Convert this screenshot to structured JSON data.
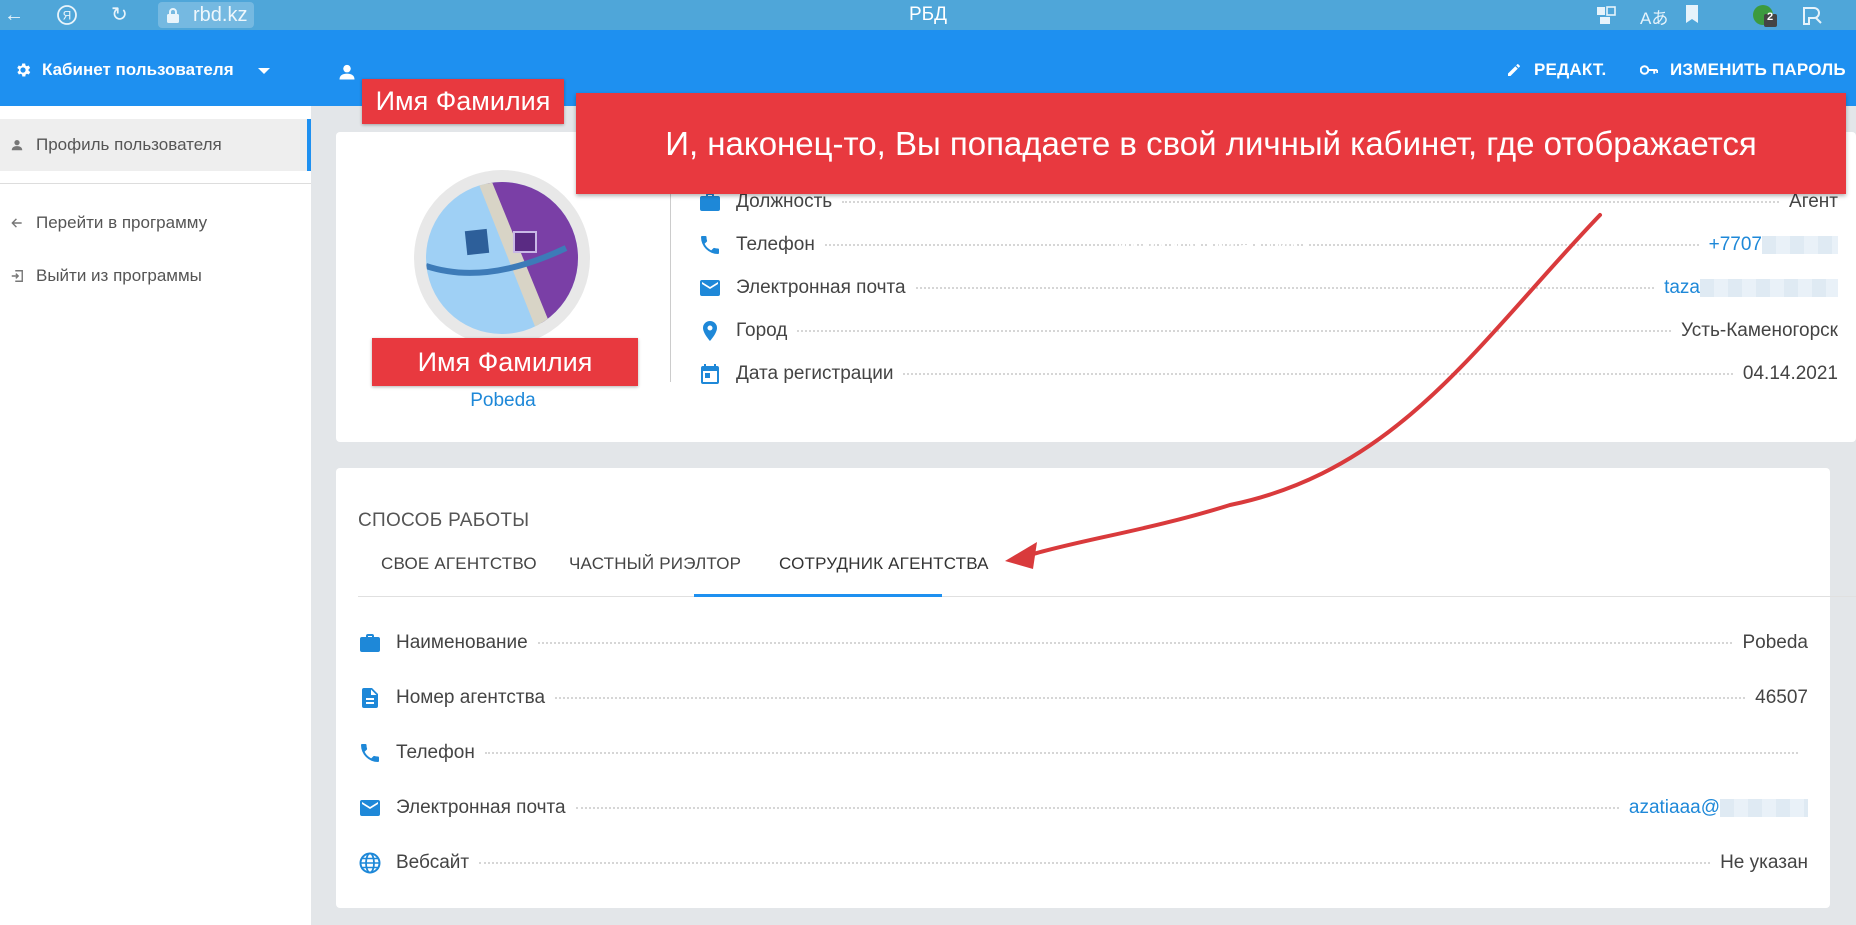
{
  "browser": {
    "url": "rbd.kz",
    "title": "РБД",
    "profile_badge": "2",
    "icons": [
      "back-icon",
      "yandex-icon",
      "reload-icon",
      "lock-icon",
      "extensions-icon",
      "translate-icon",
      "bookmark-icon",
      "profile-icon",
      "downloads-icon"
    ]
  },
  "app_bar": {
    "cabinet_title": "Кабинет пользователя",
    "user_name": "Имя Фамилия",
    "edit_label": "РЕДАКТ.",
    "change_password_label": "ИЗМЕНИТЬ ПАРОЛЬ"
  },
  "sidebar": {
    "items": [
      {
        "label": "Профиль пользователя",
        "icon": "person-icon",
        "active": true
      },
      {
        "label": "Перейти в программу",
        "icon": "arrow-left-icon",
        "active": false
      },
      {
        "label": "Выйти из программы",
        "icon": "exit-icon",
        "active": false
      }
    ]
  },
  "profile": {
    "name": "Имя Фамилия",
    "company": "Pobeda",
    "fields": [
      {
        "label": "Должность",
        "value": "Агент",
        "icon": "briefcase-icon"
      },
      {
        "label": "Телефон",
        "value": "+7707",
        "icon": "phone-icon",
        "redacted": true
      },
      {
        "label": "Электронная почта",
        "value": "taza",
        "icon": "email-icon",
        "redacted": true
      },
      {
        "label": "Город",
        "value": "Усть-Каменогорск",
        "icon": "location-icon"
      },
      {
        "label": "Дата регистрации",
        "value": "04.14.2021",
        "icon": "calendar-icon"
      }
    ]
  },
  "work": {
    "section_title": "СПОСОБ РАБОТЫ",
    "tabs": [
      "СВОЕ АГЕНТСТВО",
      "ЧАСТНЫЙ РИЭЛТОР",
      "СОТРУДНИК АГЕНТСТВА"
    ],
    "active_tab": 2,
    "fields": [
      {
        "label": "Наименование",
        "value": "Pobeda",
        "icon": "briefcase-icon"
      },
      {
        "label": "Номер агентства",
        "value": "46507",
        "icon": "document-icon"
      },
      {
        "label": "Телефон",
        "value": "",
        "icon": "phone-icon"
      },
      {
        "label": "Электронная почта",
        "value": "azatiaaa@",
        "icon": "email-icon",
        "redacted": true
      },
      {
        "label": "Вебсайт",
        "value": "Не указан",
        "icon": "globe-icon"
      }
    ]
  },
  "callout": {
    "text": "И, наконец-то, Вы попадаете в свой личный кабинет, где отображается информация"
  },
  "colors": {
    "app_bar": "#1e90f0",
    "browser_bar": "#4fa6d9",
    "annotation_red": "#e8393f",
    "link": "#1e88d8"
  }
}
